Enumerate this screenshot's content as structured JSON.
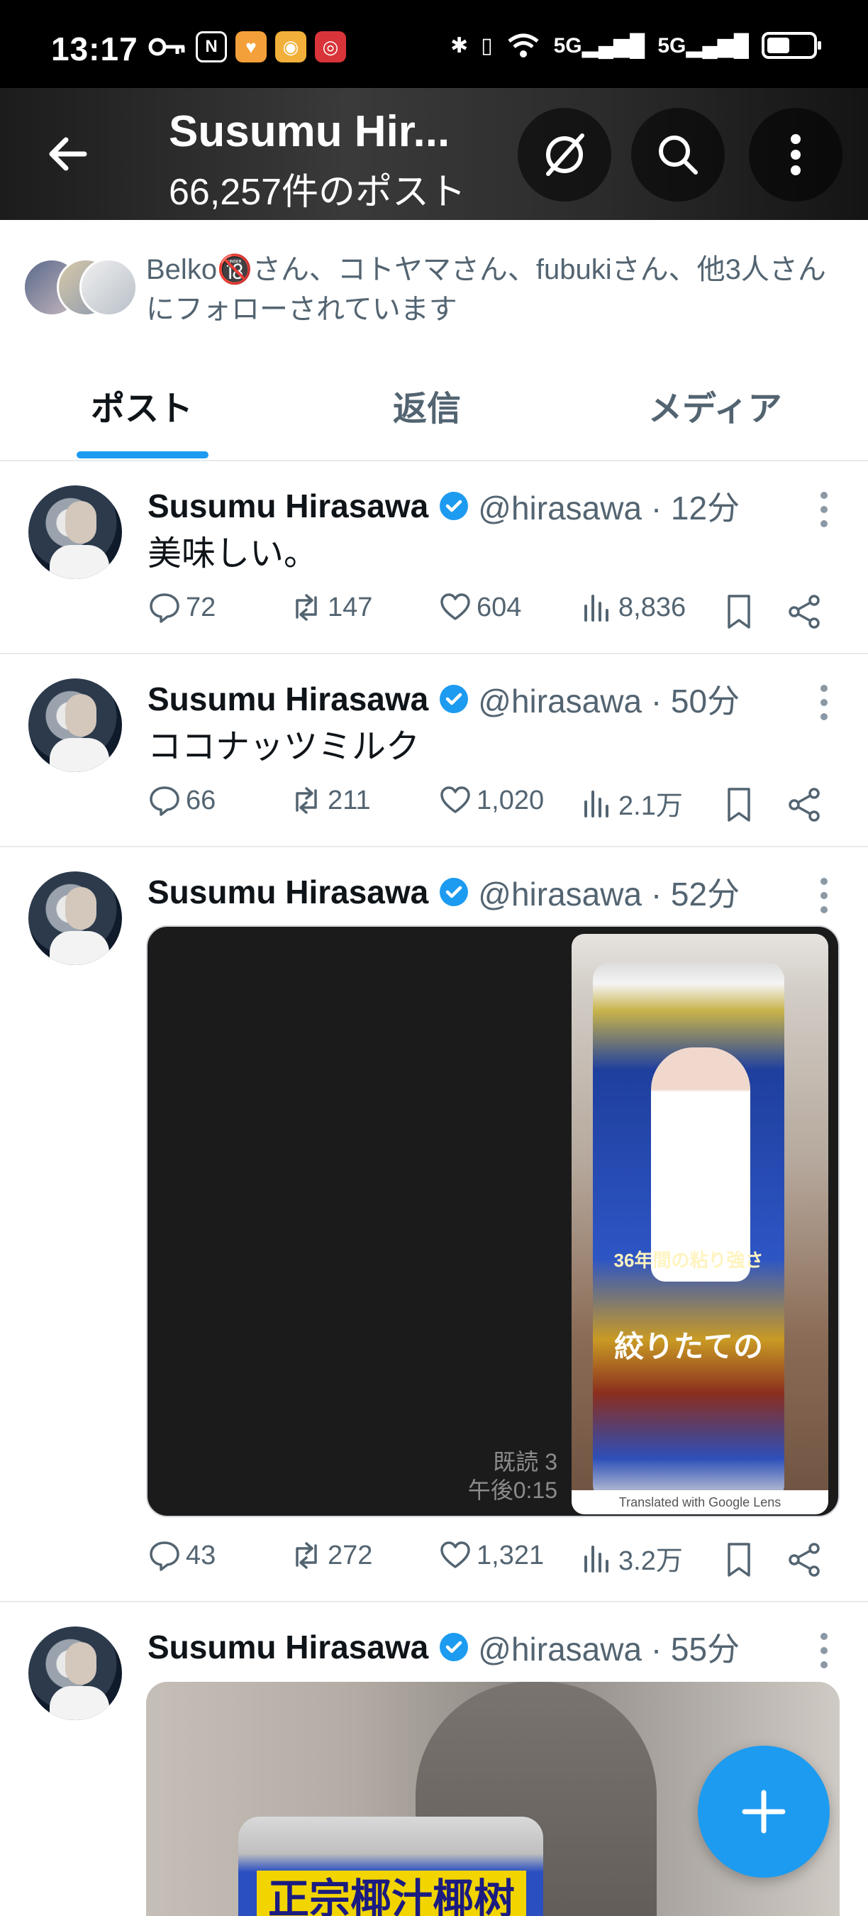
{
  "status_bar": {
    "time": "13:17",
    "network_1": "5G",
    "network_2": "5G",
    "battery_level": 0.5
  },
  "header": {
    "title": "Susumu Hir...",
    "post_count": "66,257件のポスト"
  },
  "followed_by": {
    "text": "Belko🔞さん、コトヤマさん、fubukiさん、他3人さんにフォローされています"
  },
  "tabs": [
    {
      "label": "ポスト",
      "active": true
    },
    {
      "label": "返信",
      "active": false
    },
    {
      "label": "メディア",
      "active": false
    }
  ],
  "posts": [
    {
      "name": "Susumu Hirasawa",
      "meta": "@hirasawa · 12分",
      "text": "美味しい。",
      "replies": "72",
      "reposts": "147",
      "likes": "604",
      "views": "8,836"
    },
    {
      "name": "Susumu Hirasawa",
      "meta": "@hirasawa · 50分",
      "text": "ココナッツミルク",
      "replies": "66",
      "reposts": "211",
      "likes": "1,020",
      "views": "2.1万"
    },
    {
      "name": "Susumu Hirasawa",
      "meta": "@hirasawa · 52分",
      "media_read": "既読 3",
      "media_time": "午後0:15",
      "media_can_text_1": "36年間の粘り強さ",
      "media_can_text_2": "絞りたての",
      "media_lens": "Translated with Google Lens",
      "replies": "43",
      "reposts": "272",
      "likes": "1,321",
      "views": "3.2万"
    },
    {
      "name": "Susumu Hirasawa",
      "meta": "@hirasawa · 55分",
      "media_label": "正宗椰汁椰树牌"
    }
  ],
  "colors": {
    "accent": "#1d9bf0",
    "text_primary": "#0f1419",
    "text_secondary": "#536471"
  }
}
